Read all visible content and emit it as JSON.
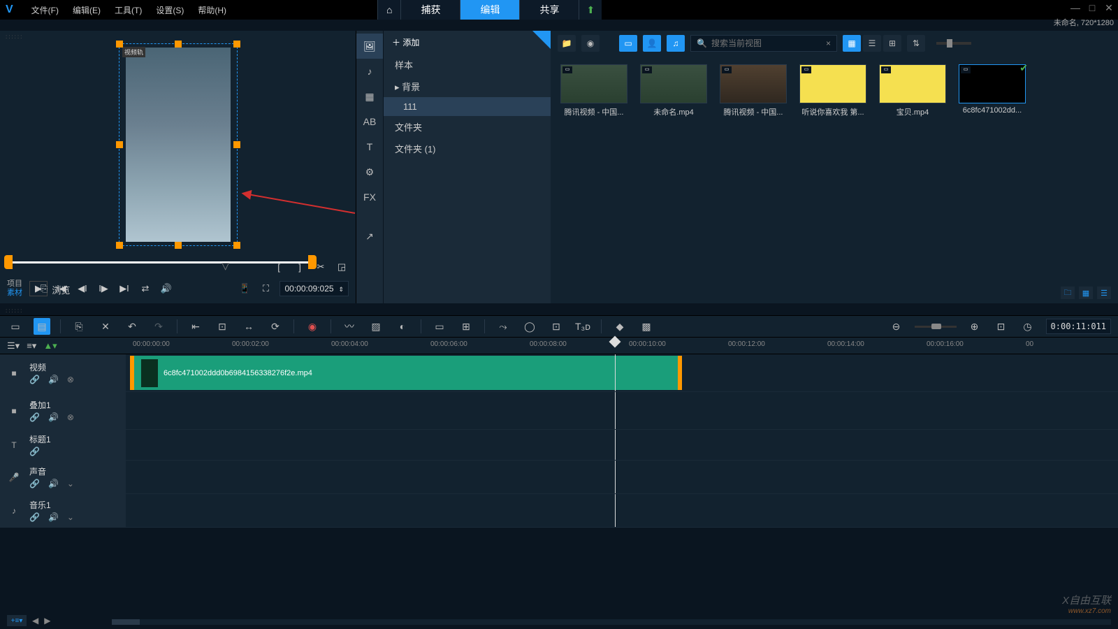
{
  "menubar": {
    "items": [
      "文件(F)",
      "编辑(E)",
      "工具(T)",
      "设置(S)",
      "帮助(H)"
    ]
  },
  "modeTabs": {
    "capture": "捕获",
    "edit": "编辑",
    "share": "共享"
  },
  "projectInfo": "未命名, 720*1280",
  "preview": {
    "trackLabel": "视频轨",
    "projectLabel": "项目",
    "materialLabel": "素材",
    "timecode": "00:00:09:025"
  },
  "library": {
    "addLabel": "添加",
    "tree": {
      "sample": "样本",
      "background": "背景",
      "folder111": "111",
      "folder": "文件夹",
      "folder1": "文件夹 (1)"
    },
    "browse": "浏览",
    "searchPlaceholder": "搜索当前视图",
    "thumbs": [
      {
        "label": "腾讯视频 - 中国..."
      },
      {
        "label": "未命名.mp4"
      },
      {
        "label": "腾讯视频 - 中国..."
      },
      {
        "label": "听说你喜欢我 第..."
      },
      {
        "label": "宝贝.mp4"
      },
      {
        "label": "6c8fc471002dd..."
      }
    ]
  },
  "timeline": {
    "duration": "0:00:11:011",
    "ruler": [
      "00:00:00:00",
      "00:00:02:00",
      "00:00:04:00",
      "00:00:06:00",
      "00:00:08:00",
      "00:00:10:00",
      "00:00:12:00",
      "00:00:14:00",
      "00:00:16:00",
      "00"
    ],
    "tracks": {
      "video": "视频",
      "overlay": "叠加1",
      "title": "标题1",
      "sound": "声音",
      "music": "音乐1"
    },
    "clipName": "6c8fc471002ddd0b6984156338276f2e.mp4"
  },
  "watermark": {
    "main": "自由互联",
    "sub": "www.xz7.com"
  }
}
